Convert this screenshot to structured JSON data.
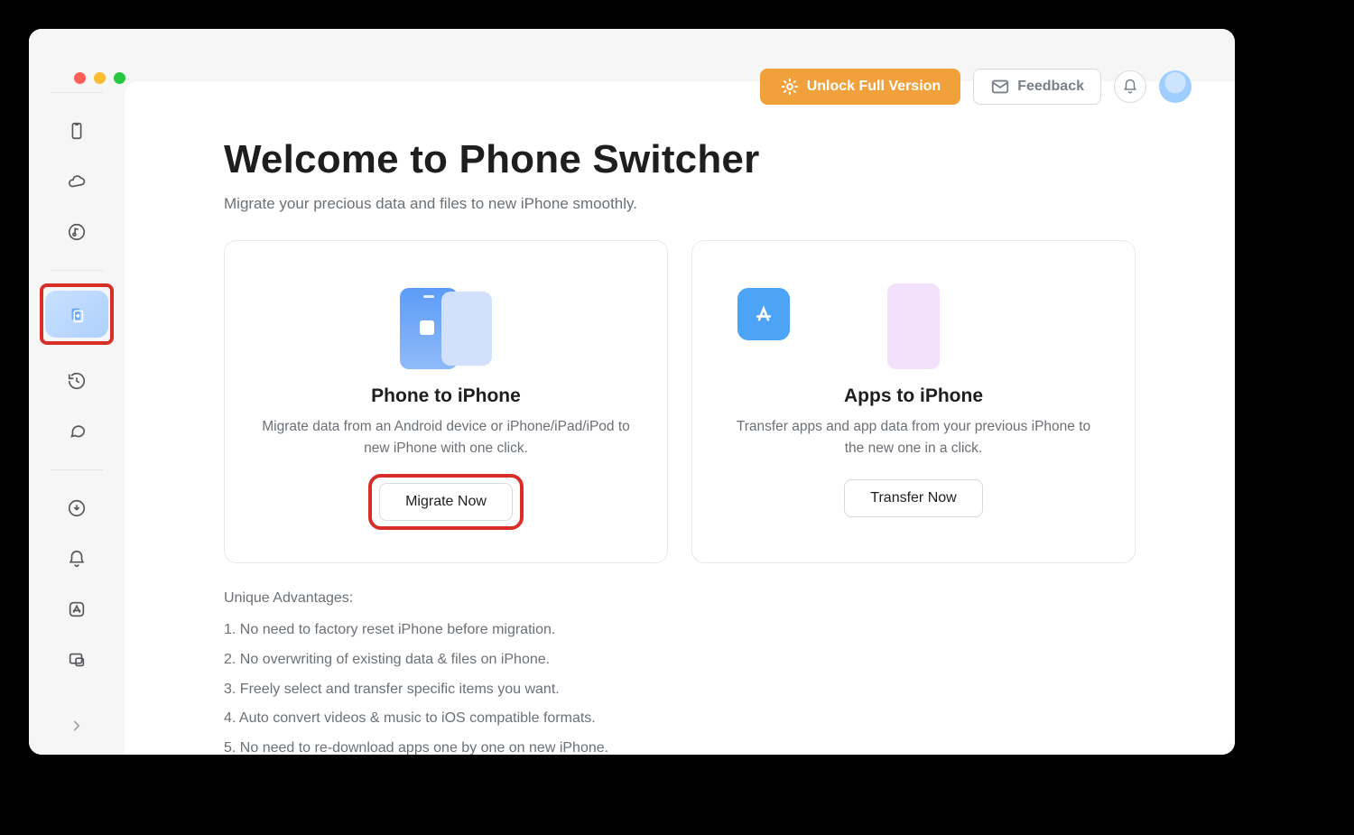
{
  "topbar": {
    "unlock_label": "Unlock Full Version",
    "feedback_label": "Feedback"
  },
  "sidebar": {
    "items": [
      {
        "name": "device"
      },
      {
        "name": "icloud"
      },
      {
        "name": "media"
      },
      {
        "name": "phone-switcher"
      },
      {
        "name": "backup"
      },
      {
        "name": "social"
      },
      {
        "name": "download"
      },
      {
        "name": "ringtone"
      },
      {
        "name": "app-store"
      },
      {
        "name": "screen"
      }
    ]
  },
  "main": {
    "title": "Welcome to Phone Switcher",
    "subtitle": "Migrate your precious data and files to new iPhone smoothly.",
    "cards": [
      {
        "title": "Phone to iPhone",
        "desc": "Migrate data from an Android device or iPhone/iPad/iPod to new iPhone with one click.",
        "button": "Migrate Now"
      },
      {
        "title": "Apps to iPhone",
        "desc": "Transfer apps and app data from your previous iPhone to the new one in a click.",
        "button": "Transfer Now"
      }
    ],
    "advantages_title": "Unique Advantages:",
    "advantages": [
      "1. No need to factory reset iPhone before migration.",
      "2. No overwriting of existing data & files on iPhone.",
      "3. Freely select and transfer specific items you want.",
      "4. Auto convert videos & music to iOS compatible formats.",
      "5. No need to re-download apps one by one on new iPhone."
    ]
  }
}
